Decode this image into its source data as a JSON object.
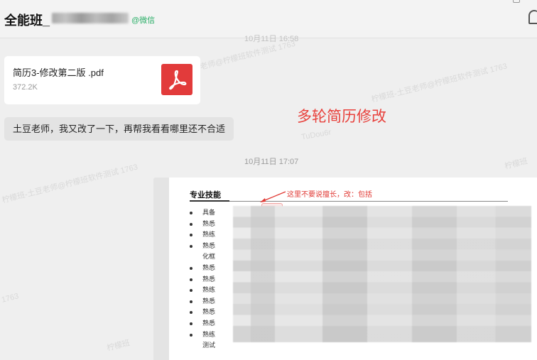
{
  "header": {
    "title": "全能班_",
    "wechat_tag": "@微信"
  },
  "timestamps": {
    "top": "10月11日 16:58",
    "middle": "10月11日 17:07"
  },
  "file_message": {
    "file_name": "简历3-修改第二版 .pdf",
    "file_size": "372.2K",
    "icon": "pdf-icon"
  },
  "text_message": {
    "text": "土豆老师，我又改了一下，再帮我看看哪里还不合适"
  },
  "annotation": {
    "text": "多轮简历修改",
    "color": "#e8413c"
  },
  "watermarks": [
    "土豆老师@柠檬班软件测试 1763",
    "柠檬班-土豆老师@柠檬班软件测试 1763",
    "TuDou6r",
    "柠檬班",
    "1763"
  ],
  "image_message": {
    "heading": "专业技能",
    "note": "这里不要说擅长，改：包括",
    "note_color": "#e13a35",
    "items": [
      {
        "text": "具备",
        "bullet": true
      },
      {
        "text": "熟悉",
        "bullet": true
      },
      {
        "text": "熟练",
        "bullet": true
      },
      {
        "text": "熟悉",
        "bullet": true
      },
      {
        "text": "化框",
        "bullet": false
      },
      {
        "text": "熟悉",
        "bullet": true
      },
      {
        "text": "熟悉",
        "bullet": true
      },
      {
        "text": "熟练",
        "bullet": true
      },
      {
        "text": "熟悉",
        "bullet": true
      },
      {
        "text": "熟悉",
        "bullet": true
      },
      {
        "text": "熟悉",
        "bullet": true
      },
      {
        "text": "熟练",
        "bullet": true
      },
      {
        "text": "测试",
        "bullet": false
      }
    ]
  }
}
